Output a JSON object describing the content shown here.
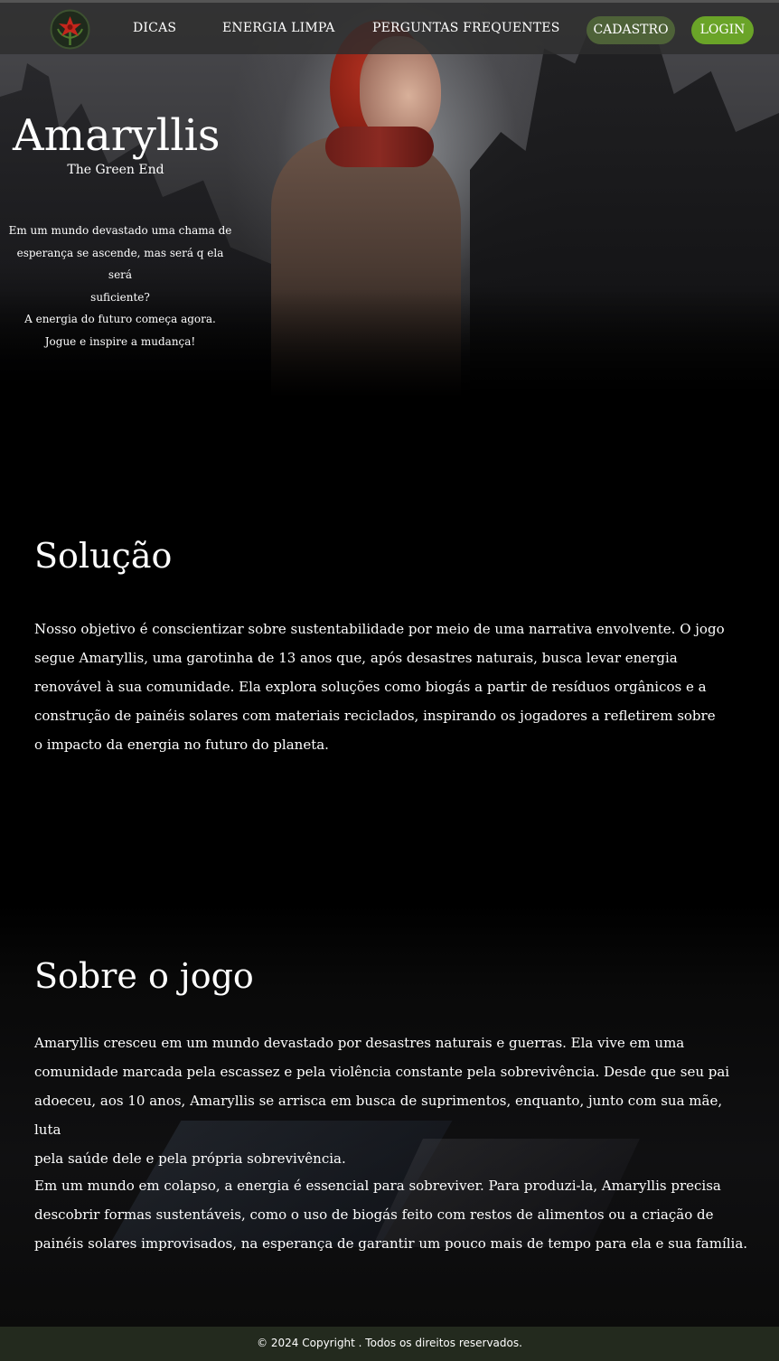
{
  "nav": {
    "logo_icon": "amaryllis-flower-logo",
    "links": [
      "DICAS",
      "ENERGIA LIMPA",
      "PERGUNTAS FREQUENTES"
    ],
    "signup_label": "CADASTRO",
    "login_label": "LOGIN",
    "colors": {
      "bar": "#2d2d2d",
      "signup": "#4e6238",
      "login": "#6aa428"
    }
  },
  "hero": {
    "title": "Amaryllis",
    "subtitle": "The Green End",
    "lines": [
      "Em um mundo devastado uma chama de",
      "esperança se ascende, mas será q ela será",
      "suficiente?",
      "A energia do futuro começa agora.",
      "Jogue e inspire a mudança!"
    ]
  },
  "solucao": {
    "title": "Solução",
    "lines": [
      "Nosso objetivo é conscientizar sobre sustentabilidade por meio de uma narrativa envolvente. O jogo",
      "segue Amaryllis, uma garotinha de 13 anos que, após desastres naturais, busca levar energia",
      "renovável à sua comunidade. Ela explora soluções como biogás a partir de resíduos orgânicos e a",
      "construção de painéis solares com materiais reciclados, inspirando os jogadores a refletirem sobre",
      "o impacto da energia no futuro do planeta."
    ]
  },
  "sobre": {
    "title": "Sobre o jogo",
    "p1_lines": [
      "Amaryllis cresceu em um mundo devastado por desastres naturais e guerras. Ela vive em uma",
      "comunidade marcada pela escassez e pela violência constante pela sobrevivência. Desde que seu pai",
      "adoeceu, aos 10 anos, Amaryllis se arrisca em busca de suprimentos, enquanto, junto com sua mãe, luta",
      "pela saúde dele e pela própria sobrevivência."
    ],
    "p2_lines": [
      "Em um mundo em colapso, a energia é essencial para sobreviver. Para produzi-la, Amaryllis precisa",
      "descobrir formas sustentáveis, como o uso de biogás feito com restos de alimentos ou a criação de",
      "painéis solares improvisados, na esperança de garantir um pouco mais de tempo para ela e sua família."
    ]
  },
  "footer": {
    "text": "© 2024 Copyright . Todos os direitos reservados.",
    "color": "#232a1e"
  }
}
